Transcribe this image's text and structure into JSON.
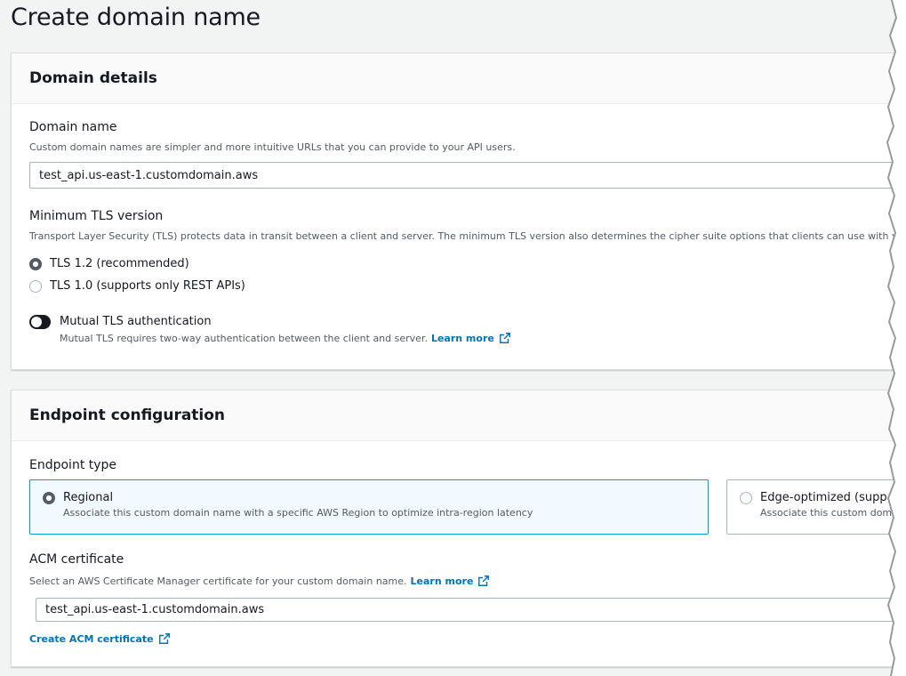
{
  "page": {
    "title": "Create domain name"
  },
  "domain_details": {
    "header": "Domain details",
    "domain_name": {
      "label": "Domain name",
      "description": "Custom domain names are simpler and more intuitive URLs that you can provide to your API users.",
      "value": "test_api.us-east-1.customdomain.aws"
    },
    "tls": {
      "label": "Minimum TLS version",
      "description": "Transport Layer Security (TLS) protects data in transit between a client and server. The minimum TLS version also determines the cipher suite options that clients can use with you",
      "options": [
        {
          "label": "TLS 1.2 (recommended)",
          "selected": true
        },
        {
          "label": "TLS 1.0 (supports only REST APIs)",
          "selected": false
        }
      ]
    },
    "mutual_tls": {
      "label": "Mutual TLS authentication",
      "description": "Mutual TLS requires two-way authentication between the client and server.",
      "learn_more": "Learn more",
      "enabled": false
    }
  },
  "endpoint_config": {
    "header": "Endpoint configuration",
    "endpoint_type": {
      "label": "Endpoint type",
      "options": [
        {
          "label": "Regional",
          "description": "Associate this custom domain name with a specific AWS Region to optimize intra-region latency",
          "selected": true
        },
        {
          "label": "Edge-optimized (supp",
          "description": "Associate this custom doma",
          "selected": false
        }
      ]
    },
    "acm": {
      "label": "ACM certificate",
      "description": "Select an AWS Certificate Manager certificate for your custom domain name.",
      "learn_more": "Learn more",
      "value": "test_api.us-east-1.customdomain.aws",
      "create_link": "Create ACM certificate"
    }
  },
  "colors": {
    "link": "#0073bb",
    "selected_border": "#00a1c9",
    "selected_bg": "#f1faff",
    "background": "#f2f3f3"
  },
  "icons": [
    "external-link-icon",
    "radio-icon",
    "toggle-icon"
  ]
}
